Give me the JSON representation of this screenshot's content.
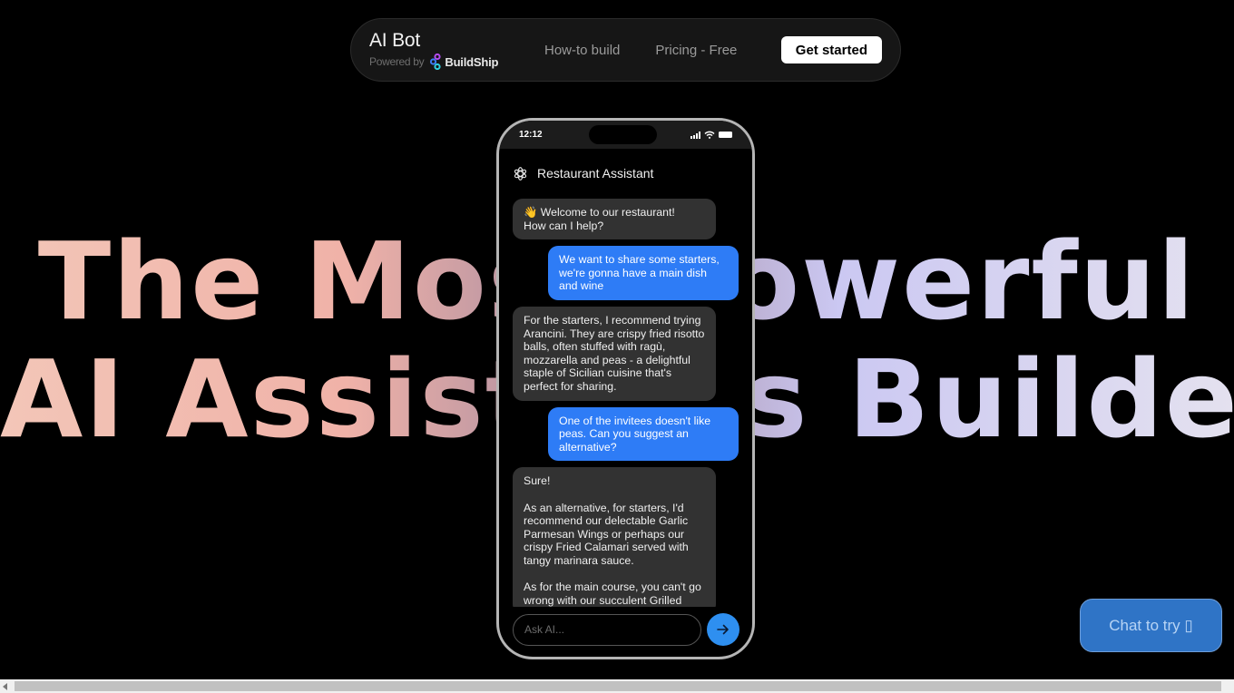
{
  "nav": {
    "brand_title": "AI Bot",
    "powered_by": "Powered by",
    "partner_name": "BuildShip",
    "links": [
      "How-to build",
      "Pricing - Free"
    ],
    "cta_label": "Get started"
  },
  "hero": {
    "line1": "The Most Powerful",
    "line2": "AI Assistants Builder"
  },
  "phone": {
    "time": "12:12",
    "status_icons": [
      "signal-icon",
      "wifi-icon",
      "battery-icon"
    ],
    "chat_title": "Restaurant Assistant",
    "messages": [
      {
        "role": "bot",
        "text": "👋 Welcome to our restaurant!\nHow can I help?"
      },
      {
        "role": "user",
        "text": "We want to share some starters, we're gonna have a main dish and wine"
      },
      {
        "role": "bot",
        "text": "For the starters, I recommend trying Arancini. They are crispy fried risotto balls, often stuffed with ragù, mozzarella and peas - a delightful staple of Sicilian cuisine that's perfect for sharing."
      },
      {
        "role": "user",
        "text": "One of the invitees doesn't like peas. Can you suggest an alternative?"
      },
      {
        "role": "bot",
        "text": "Sure!\n\nAs an alternative, for starters, I'd recommend our delectable Garlic Parmesan Wings or perhaps our crispy Fried Calamari served with tangy marinara sauce.\n\nAs for the main course, you can't go wrong with our succulent Grilled"
      }
    ],
    "input_placeholder": "Ask AI..."
  },
  "floating": {
    "chat_label": "Chat to try ▯"
  },
  "colors": {
    "user_bubble": "#2e7cf6",
    "bot_bubble": "#323232",
    "send_button": "#2e8ff0",
    "chat_try_button": "#2f74c6"
  }
}
